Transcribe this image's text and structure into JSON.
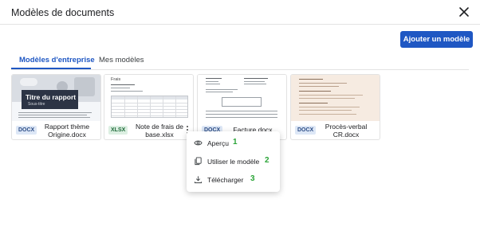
{
  "dialog": {
    "title": "Modèles de documents"
  },
  "actions": {
    "add_label": "Ajouter un modèle"
  },
  "tabs": [
    {
      "label": "Modèles d'entreprise",
      "active": true
    },
    {
      "label": "Mes modèles",
      "active": false
    }
  ],
  "cards": [
    {
      "badge": "DOCX",
      "name": "Rapport thème Origine.docx",
      "thumb_title": "Titre du rapport",
      "thumb_subtitle": "Sous-titre"
    },
    {
      "badge": "XLSX",
      "name": "Note de frais de base.xlsx",
      "thumb_title": "Frais"
    },
    {
      "badge": "DOCX",
      "name": "Facture.docx"
    },
    {
      "badge": "DOCX",
      "name": "Procès-verbal CR.docx"
    }
  ],
  "context_menu": {
    "items": [
      {
        "label": "Aperçu",
        "icon": "eye-icon",
        "number": "1"
      },
      {
        "label": "Utiliser le modèle",
        "icon": "copy-icon",
        "number": "2"
      },
      {
        "label": "Télécharger",
        "icon": "download-icon",
        "number": "3"
      }
    ]
  },
  "colors": {
    "accent": "#1f57c3",
    "step_number": "#2aa437"
  }
}
